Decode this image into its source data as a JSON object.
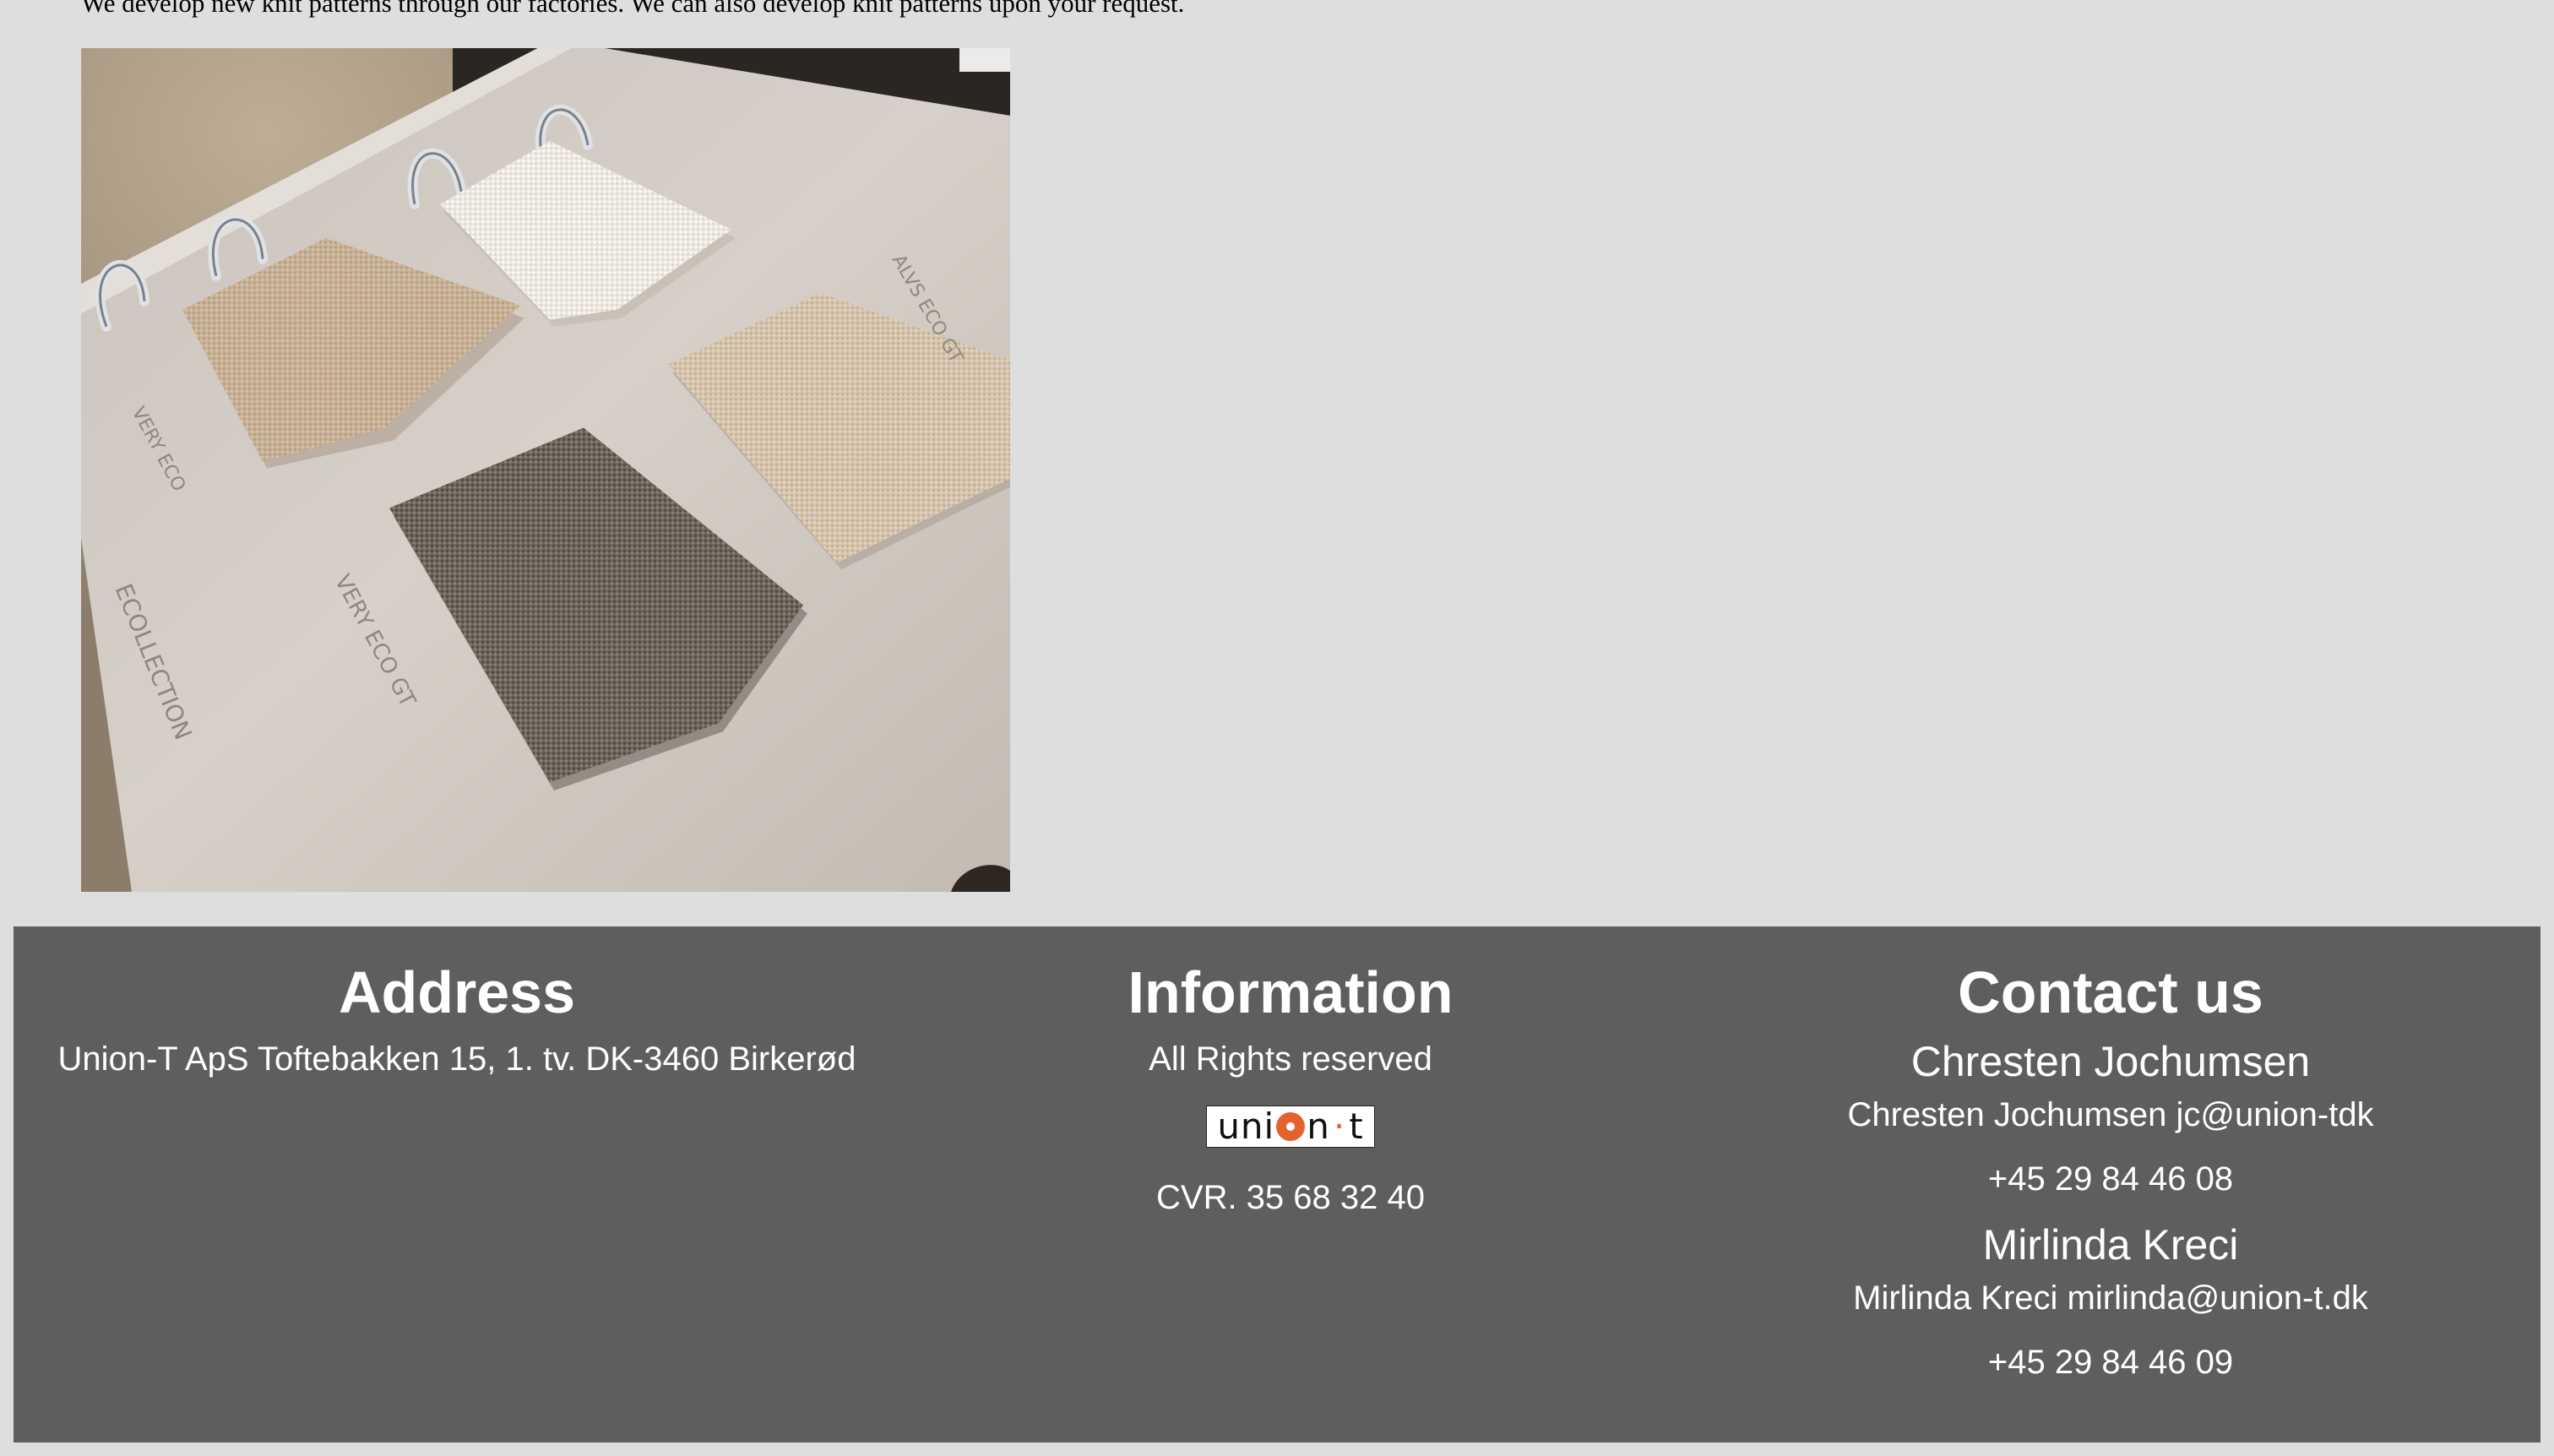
{
  "intro": {
    "text": "We develop new knit patterns through our factories. We can also develop knit patterns upon your request."
  },
  "photo": {
    "labels": [
      "VERY ECO",
      "ALVS ECO GT",
      "VERY ECO GT",
      "ECOLLECTION"
    ]
  },
  "footer": {
    "address": {
      "title": "Address",
      "text": "Union-T ApS Toftebakken 15, 1. tv. DK-3460 Birkerød"
    },
    "information": {
      "title": "Information",
      "rights": "All Rights reserved",
      "logo_text": {
        "prefix": "uni",
        "middle": "n",
        "suffix": "t"
      },
      "cvr": "CVR. 35 68 32 40"
    },
    "contact": {
      "title": "Contact us",
      "people": [
        {
          "name": "Chresten Jochumsen",
          "detail": "Chresten Jochumsen jc@union-tdk",
          "phone": "+45 29 84 46 08"
        },
        {
          "name": "Mirlinda Kreci",
          "detail": "Mirlinda Kreci mirlinda@union-t.dk",
          "phone": "+45 29 84 46 09"
        }
      ]
    }
  },
  "colors": {
    "page_background": "#dedede",
    "footer_background": "#5e5e5e",
    "brand_accent": "#e5622e"
  }
}
